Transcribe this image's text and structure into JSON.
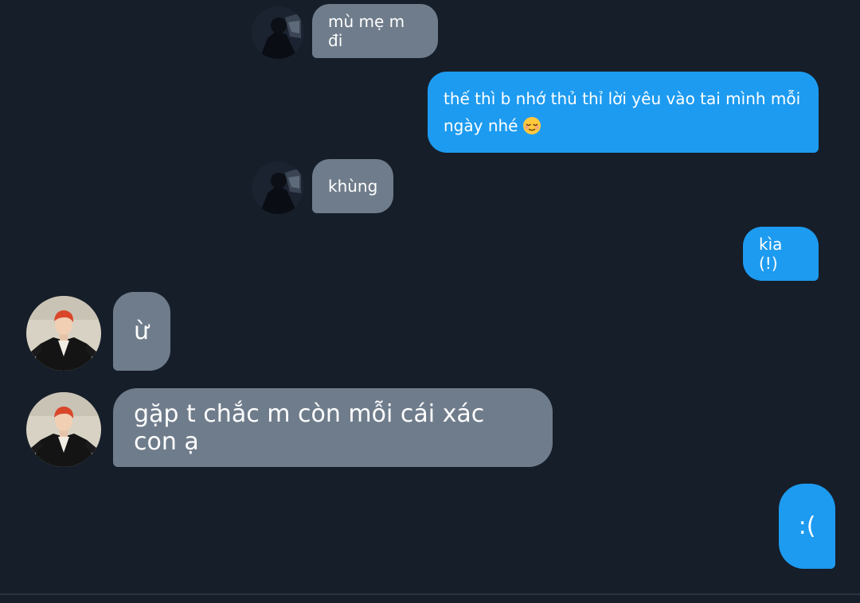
{
  "messages": [
    {
      "id": "m1",
      "sender": "other",
      "text": "mù mẹ m đi"
    },
    {
      "id": "m2",
      "sender": "self",
      "text": "thế thì b nhớ thủ thỉ lời yêu vào tai mình mỗi ngày nhé",
      "emoji": "relieved-face-emoji"
    },
    {
      "id": "m3",
      "sender": "other",
      "text": "khùng"
    },
    {
      "id": "m4",
      "sender": "self",
      "text": "kìa (!)"
    },
    {
      "id": "m5",
      "sender": "other",
      "text": "ừ"
    },
    {
      "id": "m6",
      "sender": "other",
      "text": "gặp t chắc m còn mỗi cái xác con ạ"
    },
    {
      "id": "m7",
      "sender": "self",
      "text": ":("
    }
  ],
  "colors": {
    "background": "#161e29",
    "incoming_bubble": "#6f7c8b",
    "outgoing_bubble": "#1d9bf0",
    "text": "#ffffff"
  }
}
